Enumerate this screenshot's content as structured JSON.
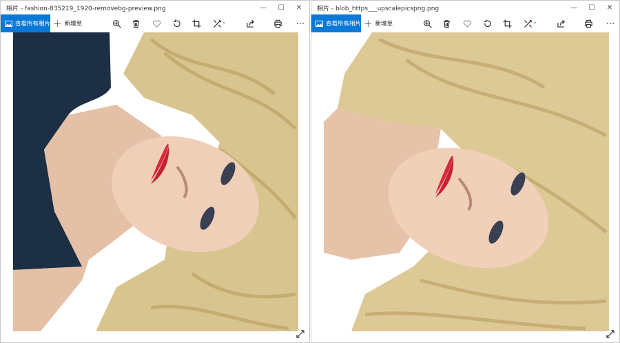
{
  "windows": [
    {
      "title": "相片 - fashion-835219_1920-removebg-preview.png",
      "view_all_label": "查看所有相片",
      "add_label": "新增至",
      "minimize": "—",
      "maximize": "☐",
      "close": "✕"
    },
    {
      "title": "相片 - blob_https___upscalepicspng.png",
      "view_all_label": "查看所有相片",
      "add_label": "新增至",
      "minimize": "—",
      "maximize": "☐",
      "close": "✕"
    }
  ],
  "toolbar_icons": [
    "zoom-in-icon",
    "delete-icon",
    "heart-icon",
    "rotate-icon",
    "crop-icon",
    "edit-icon",
    "share-icon",
    "print-icon",
    "more-icon"
  ],
  "more_label": "⋯",
  "colors": {
    "accent": "#0a78d7",
    "hair": "#d8c48f",
    "skin": "#e8c4ab",
    "lips": "#d8283a",
    "top": "#1c2f45"
  }
}
